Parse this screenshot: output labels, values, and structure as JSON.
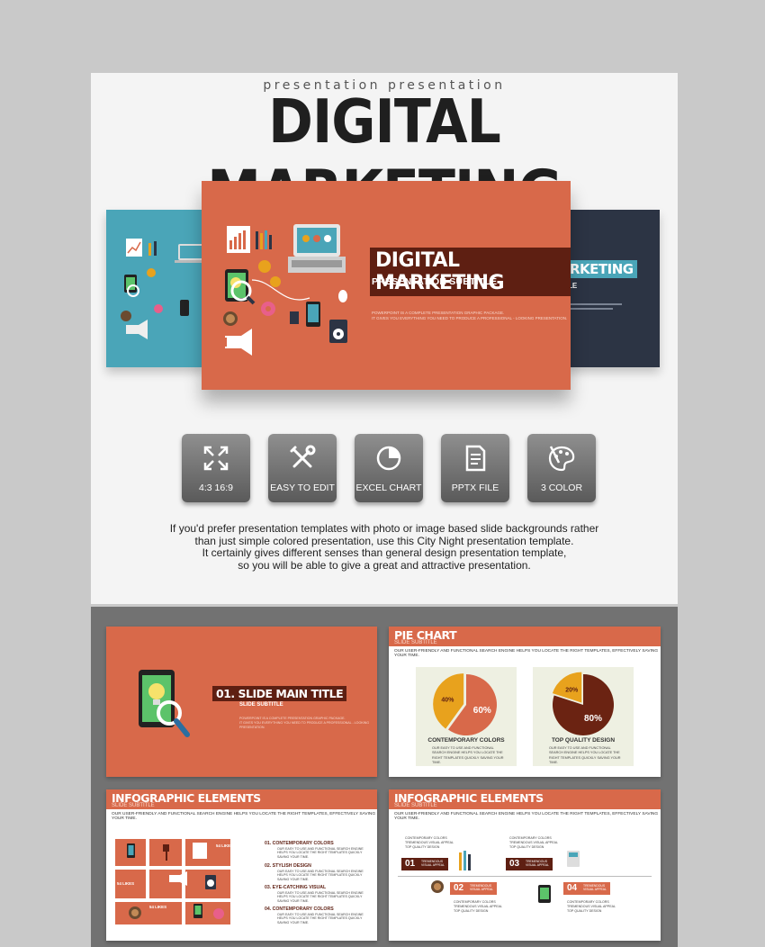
{
  "header": {
    "tagline": "presentation presentation",
    "title": "DIGITAL MARKETING"
  },
  "main_slide": {
    "title": "DIGITAL MARKETING",
    "subtitle": "PRESENTATION SUBTITLE",
    "body_line1": "POWERPOINT IS A COMPLETE PRESENTATION GRAPHIC PACKAGE.",
    "body_line2": "IT GIVES YOU EVERYTHING YOU NEED TO PRODUCE A PROFESSIONAL - LOOKING PRESENTATION."
  },
  "side_slide_right": {
    "title": "RKETING",
    "subtitle": "LE"
  },
  "features": [
    {
      "label": "4:3  16:9",
      "icon": "expand-arrows-icon"
    },
    {
      "label": "EASY TO EDIT",
      "icon": "tools-icon"
    },
    {
      "label": "EXCEL CHART",
      "icon": "pie-chart-icon"
    },
    {
      "label": "PPTX FILE",
      "icon": "document-icon"
    },
    {
      "label": "3 COLOR",
      "icon": "palette-icon"
    }
  ],
  "description": [
    "If you'd prefer presentation templates with photo or image based slide backgrounds rather",
    "than just simple colored presentation, use this City Night presentation template.",
    "It certainly gives different senses than general design presentation template,",
    "so you will be able to give a great and attractive presentation."
  ],
  "thumb1": {
    "title": "01. SLIDE MAIN TITLE",
    "subtitle": "SLIDE SUBTITLE",
    "line1": "POWERPOINT IS A COMPLETE PRESENTATION GRAPHIC PACKAGE.",
    "line2": "IT GIVES YOU EVERYTHING YOU NEED TO PRODUCE A PROFESSIONAL - LOOKING PRESENTATION."
  },
  "thumb2": {
    "title": "PIE CHART",
    "subtitle": "SLIDE SUBTITLE",
    "desc": "OUR USER-FRIENDLY AND FUNCTIONAL SEARCH ENGINE HELPS YOU LOCATE THE RIGHT TEMPLATES, EFFECTIVELY SAVING YOUR TIME.",
    "card_text": "OUR EASY TO USE AND FUNCTIONAL SEARCH ENGINE HELPS YOU LOCATE THE RIGHT TEMPLATES QUICKLY SAVING YOUR TIME."
  },
  "thumb3": {
    "title": "INFOGRAPHIC ELEMENTS",
    "subtitle": "SLIDE SUBTITLE",
    "desc": "OUR USER-FRIENDLY AND FUNCTIONAL SEARCH ENGINE HELPS YOU LOCATE THE RIGHT TEMPLATES, EFFECTIVELY SAVING YOUR TIME.",
    "list": [
      {
        "heading": "01. CONTEMPORARY COLORS",
        "text": "OUR EASY TO USE AND FUNCTIONAL SEARCH ENGINE HELPS YOU LOCATE THE RIGHT TEMPLATES QUICKLY SAVING YOUR TIME."
      },
      {
        "heading": "02. STYLISH DESIGN",
        "text": "OUR EASY TO USE AND FUNCTIONAL SEARCH ENGINE HELPS YOU LOCATE THE RIGHT TEMPLATES QUICKLY SAVING YOUR TIME."
      },
      {
        "heading": "03. EYE-CATCHING VISUAL",
        "text": "OUR EASY TO USE AND FUNCTIONAL SEARCH ENGINE HELPS YOU LOCATE THE RIGHT TEMPLATES QUICKLY SAVING YOUR TIME."
      },
      {
        "heading": "04. CONTEMPORARY COLORS",
        "text": "OUR EASY TO USE AND FUNCTIONAL SEARCH ENGINE HELPS YOU LOCATE THE RIGHT TEMPLATES QUICKLY SAVING YOUR TIME."
      }
    ],
    "tile_label": "54 LIKES"
  },
  "thumb4": {
    "title": "INFOGRAPHIC ELEMENTS",
    "subtitle": "SLIDE SUBTITLE",
    "desc": "OUR USER-FRIENDLY AND FUNCTIONAL SEARCH ENGINE HELPS YOU LOCATE THE RIGHT TEMPLATES, EFFECTIVELY SAVING YOUR TIME.",
    "steps": [
      "01",
      "02",
      "03",
      "04"
    ],
    "step_label": "TREMENDOUS VISUAL APPEAL",
    "block_lines": [
      "CONTEMPORARY COLORS",
      "TREMENDOUS VISUAL APPEAL",
      "TOP QUALITY DESIGN"
    ]
  },
  "chart_data": [
    {
      "type": "pie",
      "title": "CONTEMPORARY COLORS",
      "categories": [
        "",
        ""
      ],
      "values": [
        40,
        60
      ],
      "labels": [
        "40%",
        "60%"
      ],
      "colors": [
        "#e8a21d",
        "#d8694a"
      ]
    },
    {
      "type": "pie",
      "title": "TOP QUALITY DESIGN",
      "categories": [
        "",
        ""
      ],
      "values": [
        20,
        80
      ],
      "labels": [
        "20%",
        "80%"
      ],
      "colors": [
        "#e8a21d",
        "#6b2312"
      ]
    }
  ],
  "colors": {
    "orange": "#d8694a",
    "dark_brown": "#5e1f12",
    "teal": "#4aa5b8",
    "navy": "#2c3444",
    "gray_button": "#6e6e6e"
  }
}
